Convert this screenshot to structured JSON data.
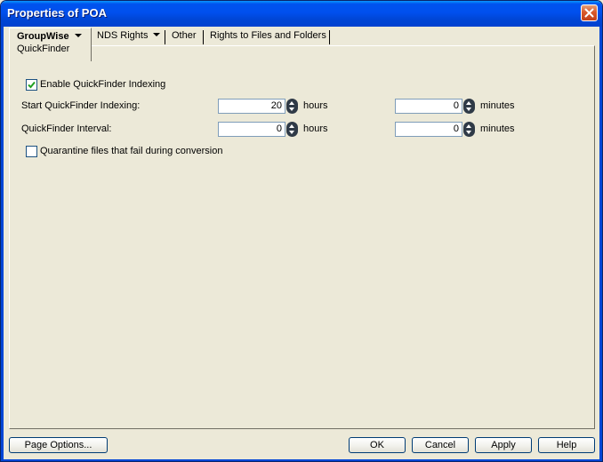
{
  "window": {
    "title": "Properties of POA"
  },
  "tabs": {
    "groupwise": {
      "label": "GroupWise",
      "sub_label": "QuickFinder"
    },
    "nds_rights": {
      "label": "NDS Rights"
    },
    "other": {
      "label": "Other"
    },
    "rights_files": {
      "label": "Rights to Files and Folders"
    }
  },
  "form": {
    "enable_indexing": {
      "label": "Enable QuickFinder Indexing",
      "checked": true
    },
    "start_indexing": {
      "label": "Start QuickFinder Indexing:",
      "hours_value": "20",
      "hours_unit": "hours",
      "minutes_value": "0",
      "minutes_unit": "minutes"
    },
    "interval": {
      "label": "QuickFinder Interval:",
      "hours_value": "0",
      "hours_unit": "hours",
      "minutes_value": "0",
      "minutes_unit": "minutes"
    },
    "quarantine": {
      "label": "Quarantine files that fail during conversion",
      "checked": false
    }
  },
  "buttons": {
    "page_options": "Page Options...",
    "ok": "OK",
    "cancel": "Cancel",
    "apply": "Apply",
    "help": "Help"
  },
  "colors": {
    "titlebar": "#0050ee",
    "dialog_bg": "#ece9d8",
    "close_button": "#d9592c",
    "checkmark": "#21a121"
  }
}
